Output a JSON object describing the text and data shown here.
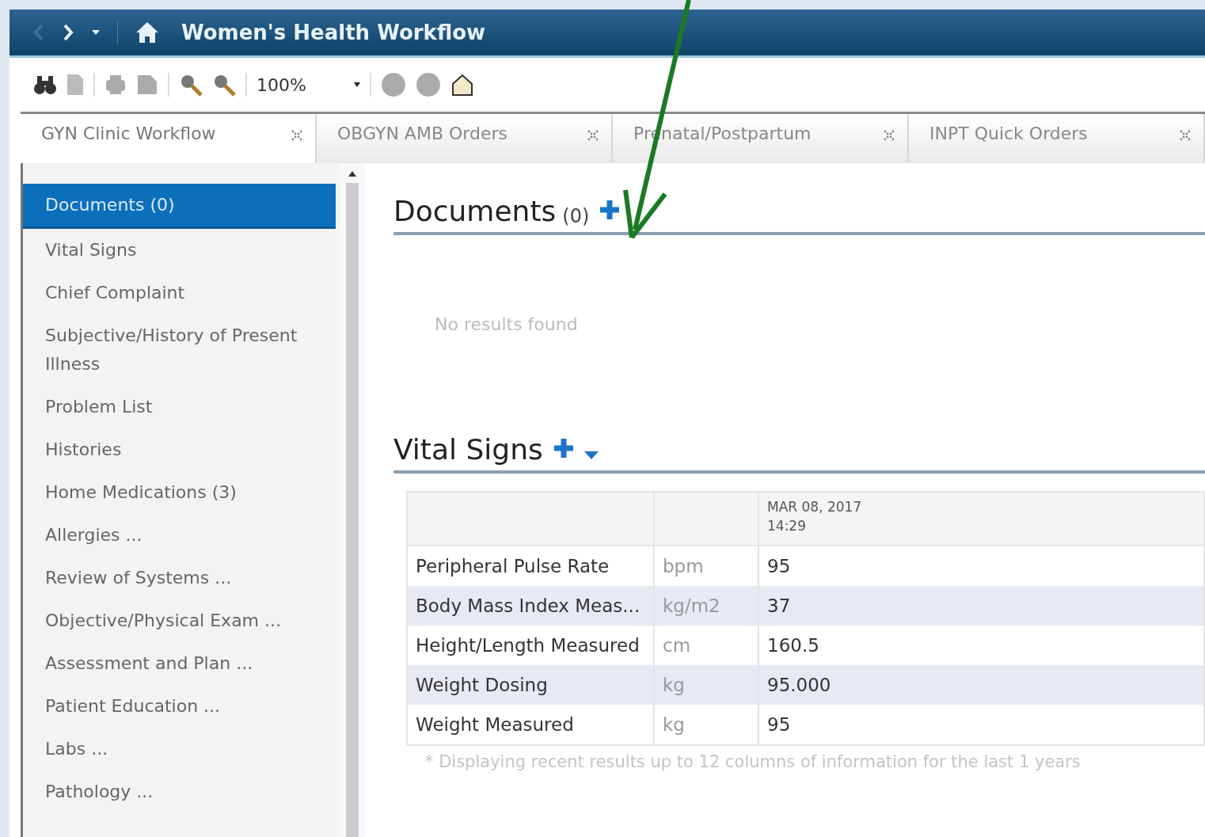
{
  "window": {
    "title": "Women's Health Workflow"
  },
  "toolbar": {
    "zoom": "100%"
  },
  "tabs": [
    {
      "label": "GYN Clinic Workflow",
      "selected": true
    },
    {
      "label": "OBGYN AMB Orders",
      "selected": false
    },
    {
      "label": "Prenatal/Postpartum",
      "selected": false
    },
    {
      "label": "INPT Quick Orders",
      "selected": false
    }
  ],
  "sidebar": {
    "items": [
      {
        "label": "Documents (0)",
        "selected": true
      },
      {
        "label": "Vital Signs",
        "selected": false
      },
      {
        "label": "Chief Complaint",
        "selected": false
      },
      {
        "label": "Subjective/History of Present Illness",
        "selected": false
      },
      {
        "label": "Problem List",
        "selected": false
      },
      {
        "label": "Histories",
        "selected": false
      },
      {
        "label": "Home Medications (3)",
        "selected": false
      },
      {
        "label": "Allergies ...",
        "selected": false
      },
      {
        "label": "Review of Systems ...",
        "selected": false
      },
      {
        "label": "Objective/Physical Exam ...",
        "selected": false
      },
      {
        "label": "Assessment and Plan ...",
        "selected": false
      },
      {
        "label": "Patient Education ...",
        "selected": false
      },
      {
        "label": "Labs ...",
        "selected": false
      },
      {
        "label": "Pathology ...",
        "selected": false
      }
    ]
  },
  "documents": {
    "title": "Documents",
    "count": "(0)",
    "empty_text": "No results found"
  },
  "vital_signs": {
    "title": "Vital Signs",
    "date": "MAR 08, 2017",
    "time": "14:29",
    "rows": [
      {
        "name": "Peripheral Pulse Rate",
        "unit": "bpm",
        "value": "95"
      },
      {
        "name": "Body Mass Index Meas...",
        "unit": "kg/m2",
        "value": "37"
      },
      {
        "name": "Height/Length Measured",
        "unit": "cm",
        "value": "160.5"
      },
      {
        "name": "Weight Dosing",
        "unit": "kg",
        "value": "95.000"
      },
      {
        "name": "Weight Measured",
        "unit": "kg",
        "value": "95"
      }
    ],
    "footnote": "* Displaying recent results up to 12 columns of information for the last 1 years"
  }
}
